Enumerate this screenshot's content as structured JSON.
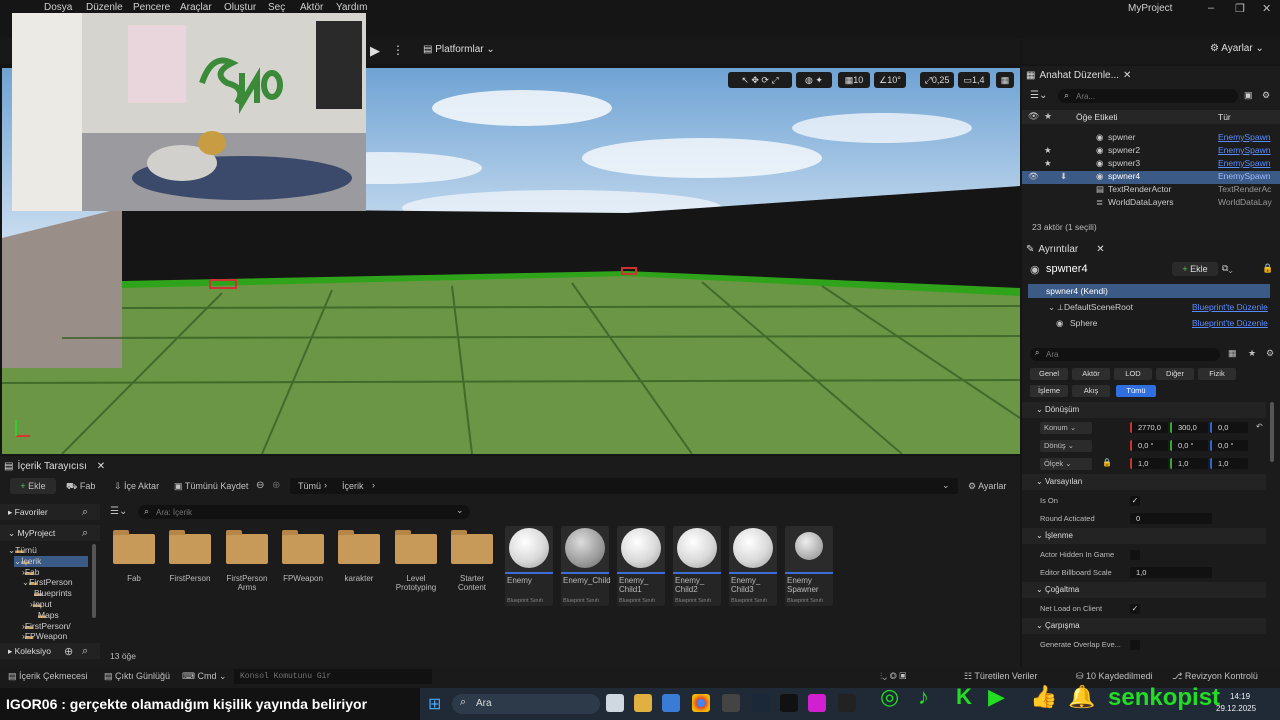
{
  "menu": [
    "Dosya",
    "Düzenle",
    "Pencere",
    "Araçlar",
    "Oluştur",
    "Seç",
    "Aktör",
    "Yardım"
  ],
  "project_name": "MyProject",
  "toolbar": {
    "platforms": "Platformlar",
    "settings": "Ayarlar"
  },
  "viewport": {
    "grid": "10",
    "angle": "10°",
    "scale": "0,25",
    "cam": "1,4"
  },
  "outliner": {
    "tab": "Anahat Düzenle...",
    "search_placeholder": "Ara...",
    "col_label": "Öğe Etiketi",
    "col_type": "Tür",
    "rows": [
      {
        "label": "spwner",
        "type": "EnemySpawn"
      },
      {
        "label": "spwner2",
        "type": "EnemySpawn"
      },
      {
        "label": "spwner3",
        "type": "EnemySpawn"
      },
      {
        "label": "spwner4",
        "type": "EnemySpawn"
      },
      {
        "label": "TextRenderActor",
        "type": "TextRenderAc"
      },
      {
        "label": "WorldDataLayers",
        "type": "WorldDataLay"
      }
    ],
    "footer": "23 aktör (1 seçili)"
  },
  "details": {
    "tab": "Ayrıntılar",
    "actor": "spwner4",
    "add_label": "Ekle",
    "self_label": "spwner4 (Kendi)",
    "components": [
      {
        "name": "DefaultSceneRoot",
        "link": "Blueprint'te Düzenle"
      },
      {
        "name": "Sphere",
        "link": "Blueprint'te Düzenle"
      }
    ],
    "search_placeholder": "Ara",
    "filters_row1": [
      "Genel",
      "Aktör",
      "LOD",
      "Diğer",
      "Fizik"
    ],
    "filters_row2": [
      "İşleme",
      "Akış",
      "Tümü"
    ],
    "sections": {
      "transform": "Dönüşüm",
      "defaults": "Varsayılan",
      "render": "İşlenme",
      "replication": "Çoğaltma",
      "collision": "Çarpışma"
    },
    "location": {
      "label": "Konum",
      "x": "2770,0",
      "y": "300,0",
      "z": "0,0"
    },
    "rotation": {
      "label": "Dönüş",
      "x": "0,0 °",
      "y": "0,0 °",
      "z": "0,0 °"
    },
    "scale": {
      "label": "Ölçek",
      "x": "1,0",
      "y": "1,0",
      "z": "1,0"
    },
    "is_on": "Is On",
    "round_label": "Round Acticated",
    "round_value": "0",
    "hidden_label": "Actor Hidden In Game",
    "billboard_label": "Editor Billboard Scale",
    "billboard_value": "1,0",
    "netload_label": "Net Load on Client",
    "overlap_label": "Generate Overlap Eve..."
  },
  "content": {
    "tab": "İçerik Tarayıcısı",
    "add": "Ekle",
    "fab": "Fab",
    "import": "İçe Aktar",
    "save_all": "Tümünü Kaydet",
    "crumb_all": "Tümü",
    "crumb_content": "İçerik",
    "settings": "Ayarlar",
    "favorites": "Favoriler",
    "project": "MyProject",
    "search_placeholder": "Ara: İçerik",
    "collections": "Koleksiyo",
    "count": "13 öğe",
    "tree": [
      "Tümü",
      "İçerik",
      "Fab",
      "FirstPerson",
      "Blueprints",
      "Input",
      "Maps",
      "FirstPerson/",
      "FPWeapon"
    ],
    "folders": [
      "Fab",
      "FirstPerson",
      "FirstPerson Arms",
      "FPWeapon",
      "karakter",
      "Level Prototyping",
      "Starter Content"
    ],
    "assets": [
      {
        "name": "Enemy",
        "kind": "Blueprint Sınıfı"
      },
      {
        "name": "Enemy_Child",
        "kind": "Blueprint Sınıfı"
      },
      {
        "name": "Enemy_ Child1",
        "kind": "Blueprint Sınıfı"
      },
      {
        "name": "Enemy_ Child2",
        "kind": "Blueprint Sınıfı"
      },
      {
        "name": "Enemy_ Child3",
        "kind": "Blueprint Sınıfı"
      },
      {
        "name": "Enemy Spawner",
        "kind": "Blueprint Sınıfı"
      }
    ]
  },
  "status": {
    "drawer": "İçerik Çekmecesi",
    "output": "Çıktı Günlüğü",
    "cmd": "Cmd",
    "cmd_placeholder": "Konsol Komutunu Gir",
    "derived": "Türetilen Veriler",
    "unsaved": "10 Kaydedilmedi",
    "revision": "Revizyon Kontrolü"
  },
  "overlay": {
    "caption": "IGOR06 : gerçekte olamadığım kişilik yayında beliriyor",
    "brand": "senkopist"
  },
  "taskbar": {
    "search": "Ara",
    "time": "14:19",
    "date": "29.12.2025"
  },
  "colors": {
    "accent": "#2f6fe0",
    "selected_row": "#3c5a86",
    "link": "#5b8cff"
  }
}
